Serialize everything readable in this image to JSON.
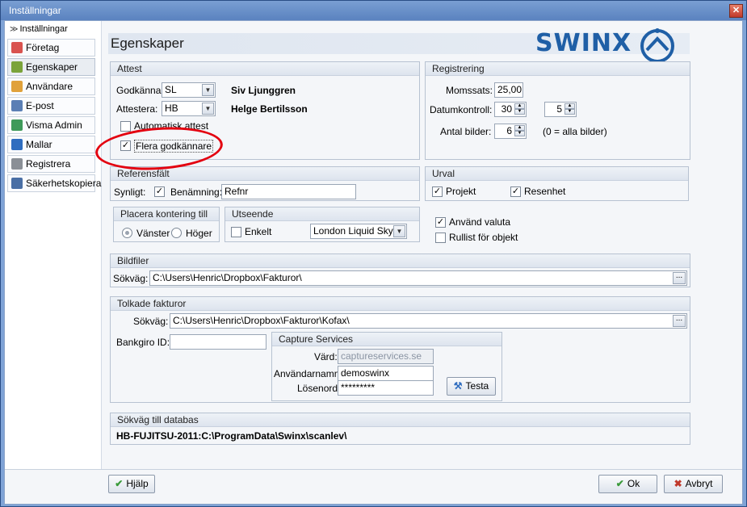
{
  "window": {
    "title": "Inställningar",
    "close_glyph": "✕"
  },
  "nav": {
    "header": "Inställningar",
    "items": [
      {
        "label": "Företag",
        "icon": "company-icon"
      },
      {
        "label": "Egenskaper",
        "icon": "properties-icon",
        "selected": true
      },
      {
        "label": "Användare",
        "icon": "users-icon"
      },
      {
        "label": "E-post",
        "icon": "email-icon"
      },
      {
        "label": "Visma Admin",
        "icon": "visma-icon"
      },
      {
        "label": "Mallar",
        "icon": "templates-icon"
      },
      {
        "label": "Registrera",
        "icon": "register-icon"
      },
      {
        "label": "Säkerhetskopiera",
        "icon": "backup-icon"
      }
    ]
  },
  "page": {
    "title": "Egenskaper",
    "logo_text": "SWINX"
  },
  "attest": {
    "title": "Attest",
    "godkanna_label": "Godkänna:",
    "godkanna_value": "SL",
    "godkanna_name": "Siv Ljunggren",
    "attestera_label": "Attestera:",
    "attestera_value": "HB",
    "attestera_name": "Helge Bertilsson",
    "auto_label": "Automatisk attest",
    "auto_checked": false,
    "flera_label": "Flera godkännare",
    "flera_checked": true
  },
  "registrering": {
    "title": "Registrering",
    "momssats_label": "Momssats:",
    "momssats_value": "25,00",
    "datumkontroll_label": "Datumkontroll:",
    "datumkontroll_value1": "30",
    "datumkontroll_value2": "5",
    "antal_label": "Antal bilder:",
    "antal_value": "6",
    "antal_hint": "(0 = alla bilder)"
  },
  "referens": {
    "title": "Referensfält",
    "synligt_label": "Synligt:",
    "synligt_checked": true,
    "benamning_label": "Benämning:",
    "benamning_value": "Refnr"
  },
  "urval": {
    "title": "Urval",
    "projekt_label": "Projekt",
    "projekt_checked": true,
    "resenhet_label": "Resenhet",
    "resenhet_checked": true
  },
  "kontering": {
    "title": "Placera kontering till",
    "vanster_label": "Vänster",
    "hoger_label": "Höger",
    "selected": "Vänster"
  },
  "utseende": {
    "title": "Utseende",
    "enkelt_label": "Enkelt",
    "enkelt_checked": false,
    "theme_value": "London Liquid Sky"
  },
  "options": {
    "valuta_label": "Använd valuta",
    "valuta_checked": true,
    "rullist_label": "Rullist för objekt",
    "rullist_checked": false
  },
  "bildfiler": {
    "title": "Bildfiler",
    "sokvag_label": "Sökväg:",
    "sokvag_value": "C:\\Users\\Henric\\Dropbox\\Fakturor\\"
  },
  "tolkade": {
    "title": "Tolkade fakturor",
    "sokvag_label": "Sökväg:",
    "sokvag_value": "C:\\Users\\Henric\\Dropbox\\Fakturor\\Kofax\\",
    "bankgiro_label": "Bankgiro ID:",
    "bankgiro_value": ""
  },
  "capture": {
    "title": "Capture Services",
    "vard_label": "Värd:",
    "vard_value": "captureservices.se",
    "user_label": "Användarnamn:",
    "user_value": "demoswinx",
    "pass_label": "Lösenord:",
    "pass_value": "*********",
    "test_label": "Testa"
  },
  "databas": {
    "title": "Sökväg till databas",
    "path": "HB-FUJITSU-2011:C:\\ProgramData\\Swinx\\scanlev\\"
  },
  "footer": {
    "help_label": "Hjälp",
    "ok_label": "Ok",
    "cancel_label": "Avbryt"
  },
  "colors": {
    "accent": "#1f5fa6",
    "highlight_circle": "#e3000f",
    "title_bar": "#6b91c9"
  }
}
